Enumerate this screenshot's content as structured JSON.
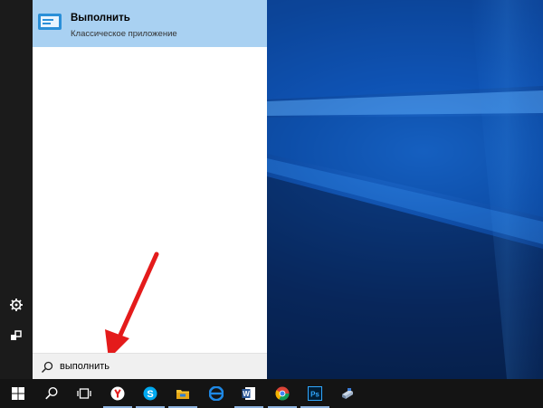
{
  "search_result": {
    "title": "Выполнить",
    "subtitle": "Классическое приложение",
    "icon": "run-app-icon"
  },
  "search_box": {
    "value": "выполнить",
    "icon": "search-icon"
  },
  "start_rail": {
    "items": [
      "all-apps-icon",
      "settings-icon",
      "power-icon"
    ]
  },
  "taskbar": {
    "items": [
      "start-button",
      "search-button",
      "task-view-button",
      "yandex-browser",
      "skype",
      "file-explorer",
      "edge",
      "word",
      "chrome",
      "photoshop",
      "app-unknown"
    ]
  },
  "colors": {
    "result_highlight": "#a9d1f2",
    "arrow": "#e41b1b",
    "taskbar": "#141414",
    "rail": "#1b1b1b"
  }
}
